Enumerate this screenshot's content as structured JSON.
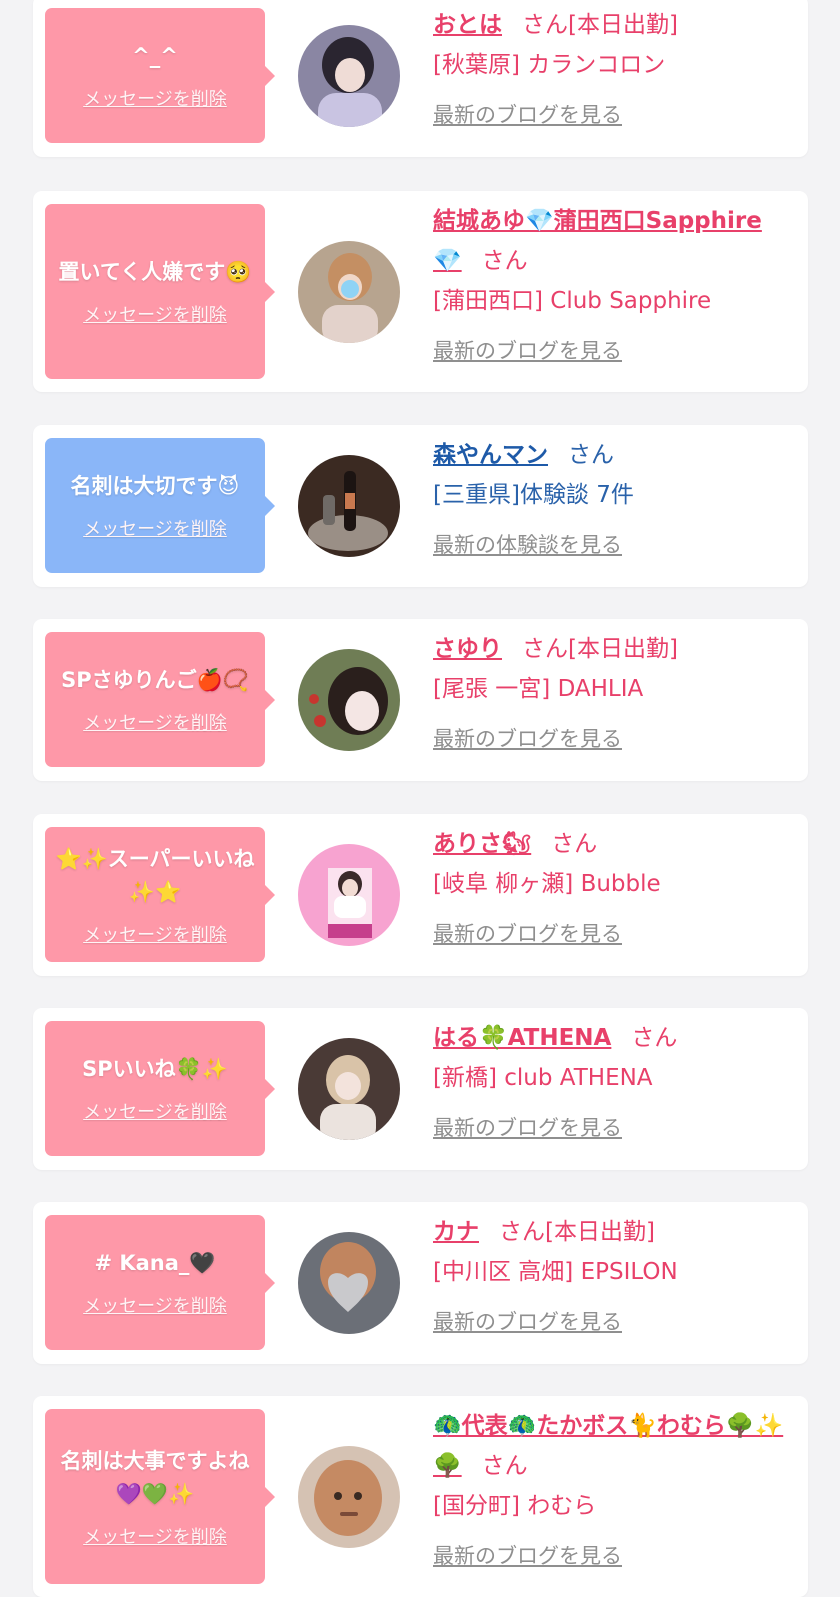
{
  "delete_label": "メッセージを削除",
  "blog_link": "最新のブログを見る",
  "review_link": "最新の体験談を見る",
  "san_suffix": "さん",
  "cards": [
    {
      "message": "^_^",
      "name": "おとは",
      "name_suffix": "さん[本日出勤]",
      "shop": "[秋葉原] カランコロン",
      "link": "最新のブログを見る"
    },
    {
      "message": "置いてく人嫌です🥺",
      "name": "結城あゆ💎蒲田西口Sapphire 💎",
      "name_suffix": "さん",
      "shop": "[蒲田西口] Club Sapphire",
      "link": "最新のブログを見る"
    },
    {
      "message": "名刺は大切です😈",
      "name": "森やんマン",
      "name_suffix": "さん",
      "shop": "[三重県]体験談 7件",
      "link": "最新の体験談を見る"
    },
    {
      "message": "SPさゆりんご🍎📿",
      "name": "さゆり",
      "name_suffix": "さん[本日出勤]",
      "shop": "[尾張 一宮] DAHLIA",
      "link": "最新のブログを見る"
    },
    {
      "message": "⭐✨スーパーいいね✨⭐",
      "name": "ありさ🐿",
      "name_suffix": "さん",
      "shop": "[岐阜 柳ヶ瀬] Bubble",
      "link": "最新のブログを見る"
    },
    {
      "message": "SPいいね🍀✨",
      "name": "はる🍀ATHENA",
      "name_suffix": "さん",
      "shop": "[新橋] club ATHENA",
      "link": "最新のブログを見る"
    },
    {
      "message": "# Kana_🖤",
      "name": "カナ",
      "name_suffix": "さん[本日出勤]",
      "shop": "[中川区 高畑] EPSILON",
      "link": "最新のブログを見る"
    },
    {
      "message": "名刺は大事ですよね💜💚✨",
      "name": "🦚代表🦚たかボス🐈わむら🌳✨🌳",
      "name_suffix": "さん",
      "shop": "[国分町] わむら",
      "link": "最新のブログを見る"
    }
  ],
  "colors": {
    "pink_bubble": "#fe98a8",
    "blue_bubble": "#8ab6f8",
    "pink_text": "#e8406a",
    "blue_text": "#1e5aa8",
    "link_gray": "#8f8f8f"
  }
}
